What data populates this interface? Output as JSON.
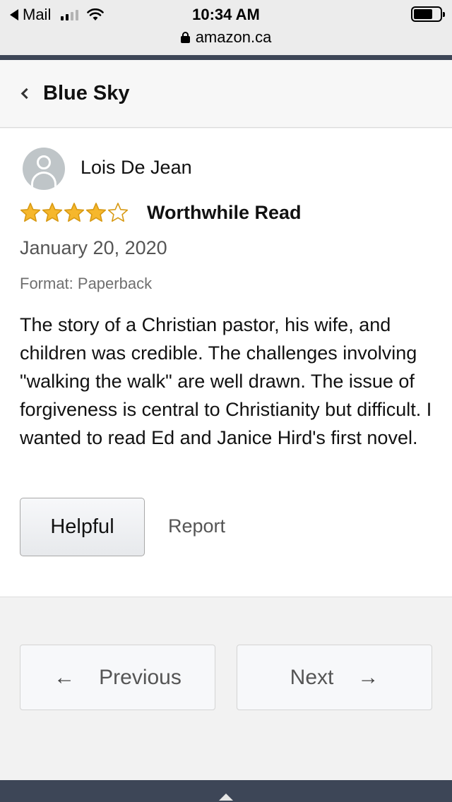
{
  "status_bar": {
    "back_app": "Mail",
    "time": "10:34 AM",
    "url": "amazon.ca",
    "battery_level": 0.72
  },
  "header": {
    "title": "Blue Sky"
  },
  "review": {
    "reviewer_name": "Lois De Jean",
    "rating": 4,
    "rating_max": 5,
    "title": "Worthwhile Read",
    "date": "January 20, 2020",
    "format": "Format: Paperback",
    "body": "The story of a Christian pastor, his wife, and children was credible. The challenges involving \"walking the walk\" are well drawn. The issue of forgiveness is central to Christianity but difficult. I wanted to read Ed and Janice Hird's first novel.",
    "helpful_label": "Helpful",
    "report_label": "Report"
  },
  "pagination": {
    "previous_label": "Previous",
    "next_label": "Next",
    "previous_arrow": "←",
    "next_arrow": "→"
  },
  "colors": {
    "star_fill": "#f6b72c",
    "star_stroke": "#d89a14",
    "nav_dark": "#3d4657"
  }
}
